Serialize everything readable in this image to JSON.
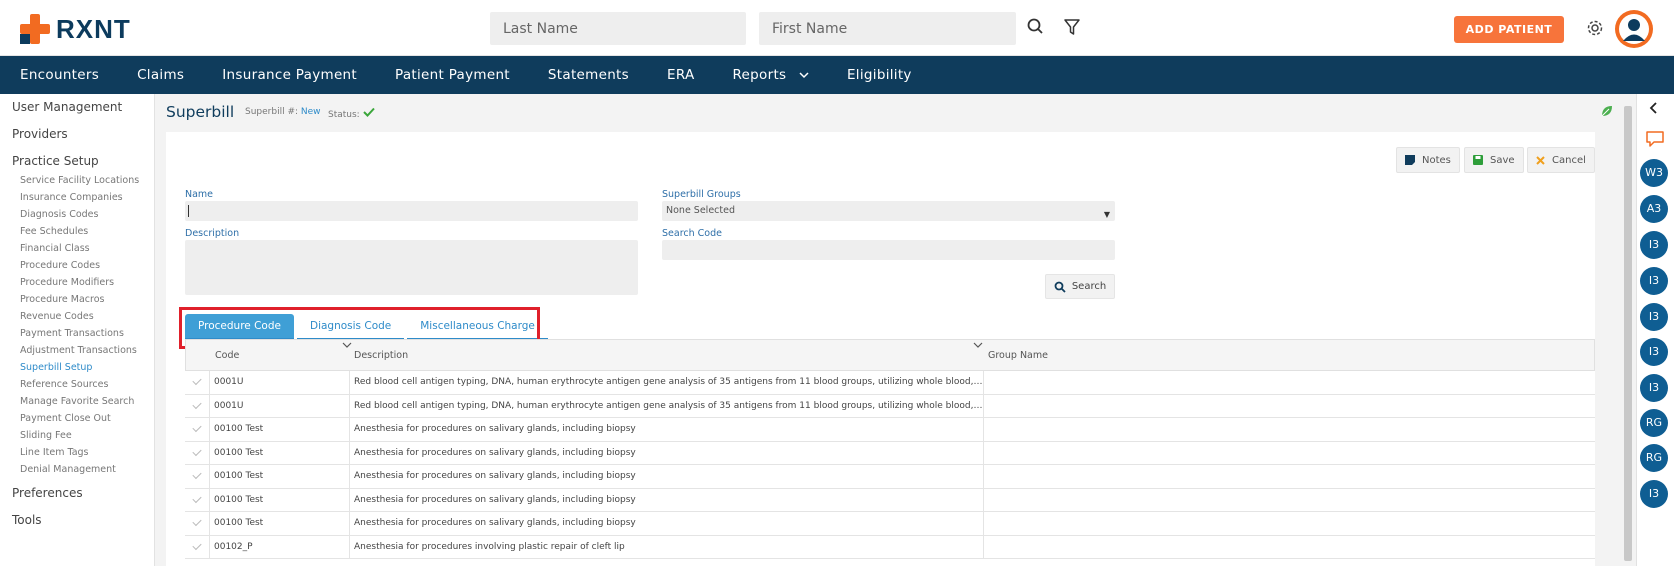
{
  "app": {
    "name": "RXNT"
  },
  "header": {
    "last_name_placeholder": "Last Name",
    "first_name_placeholder": "First Name",
    "add_patient_label": "ADD PATIENT"
  },
  "nav": {
    "items": [
      "Encounters",
      "Claims",
      "Insurance Payment",
      "Patient Payment",
      "Statements",
      "ERA",
      "Reports",
      "Eligibility"
    ]
  },
  "sidebar": {
    "user_management": "User Management",
    "providers": "Providers",
    "practice_setup": "Practice Setup",
    "practice_items": [
      "Service Facility Locations",
      "Insurance Companies",
      "Diagnosis Codes",
      "Fee Schedules",
      "Financial Class",
      "Procedure Codes",
      "Procedure Modifiers",
      "Procedure Macros",
      "Revenue Codes",
      "Payment Transactions",
      "Adjustment Transactions",
      "Superbill Setup",
      "Reference Sources",
      "Manage Favorite Search",
      "Payment Close Out",
      "Sliding Fee",
      "Line Item Tags",
      "Denial Management"
    ],
    "active_item": "Superbill Setup",
    "preferences": "Preferences",
    "tools": "Tools"
  },
  "page": {
    "title": "Superbill",
    "superbill_label": "Superbill #:",
    "superbill_value": "New",
    "status_label": "Status:"
  },
  "toolbar": {
    "notes": "Notes",
    "save": "Save",
    "cancel": "Cancel"
  },
  "form": {
    "name_label": "Name",
    "name_value": "",
    "description_label": "Description",
    "groups_label": "Superbill Groups",
    "groups_value": "None Selected",
    "search_code_label": "Search Code",
    "search_button": "Search"
  },
  "tabs": [
    "Procedure Code",
    "Diagnosis Code",
    "Miscellaneous Charge"
  ],
  "active_tab": "Procedure Code",
  "table": {
    "columns": [
      "Code",
      "Description",
      "Group Name"
    ],
    "rows": [
      {
        "code": "0001U",
        "description": "Red blood cell antigen typing, DNA, human erythrocyte antigen gene analysis of 35 antigens from 11 blood groups, utilizing whole blood, com...",
        "group": ""
      },
      {
        "code": "0001U",
        "description": "Red blood cell antigen typing, DNA, human erythrocyte antigen gene analysis of 35 antigens from 11 blood groups, utilizing whole blood, com...",
        "group": ""
      },
      {
        "code": "00100 Test",
        "description": "Anesthesia for procedures on salivary glands, including biopsy",
        "group": ""
      },
      {
        "code": "00100 Test",
        "description": "Anesthesia for procedures on salivary glands, including biopsy",
        "group": ""
      },
      {
        "code": "00100 Test",
        "description": "Anesthesia for procedures on salivary glands, including biopsy",
        "group": ""
      },
      {
        "code": "00100 Test",
        "description": "Anesthesia for procedures on salivary glands, including biopsy",
        "group": ""
      },
      {
        "code": "00100 Test",
        "description": "Anesthesia for procedures on salivary glands, including biopsy",
        "group": ""
      },
      {
        "code": "00102_P",
        "description": "Anesthesia for procedures involving plastic repair of cleft lip",
        "group": ""
      }
    ]
  },
  "right_rail": {
    "badges": [
      "W3",
      "A3",
      "I3",
      "I3",
      "I3",
      "I3",
      "I3",
      "RG",
      "RG",
      "I3"
    ]
  },
  "colors": {
    "brand_orange": "#f26b21",
    "nav_blue": "#0f3c5c",
    "accent_blue": "#2e8bc9",
    "highlight_red": "#e0202b"
  }
}
